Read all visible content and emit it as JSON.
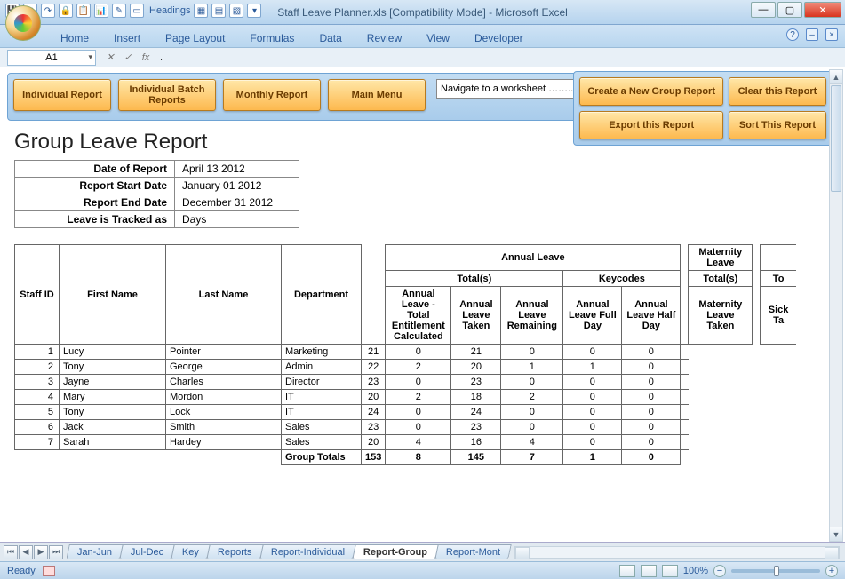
{
  "window": {
    "title": "Staff Leave Planner.xls  [Compatibility Mode] - Microsoft Excel",
    "qat_headings": "Headings"
  },
  "ribbon": {
    "tabs": [
      "Home",
      "Insert",
      "Page Layout",
      "Formulas",
      "Data",
      "Review",
      "View",
      "Developer"
    ]
  },
  "namebox": "A1",
  "formula": ".",
  "toolbar": {
    "individual_report": "Individual Report",
    "individual_batch": "Individual Batch Reports",
    "monthly_report": "Monthly Report",
    "main_menu": "Main Menu",
    "navigate_placeholder": "Navigate to a worksheet …….."
  },
  "right_buttons": {
    "create_new": "Create a New Group Report",
    "clear": "Clear this Report",
    "export": "Export this Report",
    "sort": "Sort This Report"
  },
  "report": {
    "title": "Group Leave Report",
    "meta": {
      "date_label": "Date of Report",
      "date_val": "April 13 2012",
      "start_label": "Report Start Date",
      "start_val": "January 01 2012",
      "end_label": "Report End Date",
      "end_val": "December 31 2012",
      "track_label": "Leave is Tracked as",
      "track_val": "Days"
    }
  },
  "headers": {
    "staff_id": "Staff ID",
    "first_name": "First Name",
    "last_name": "Last Name",
    "department": "Department",
    "annual_leave": "Annual Leave",
    "totals": "Total(s)",
    "keycodes": "Keycodes",
    "al_total_ent": "Annual Leave - Total Entitlement Calculated",
    "al_taken": "Annual Leave Taken",
    "al_remaining": "Annual Leave Remaining",
    "al_full": "Annual Leave Full Day",
    "al_half": "Annual Leave Half Day",
    "maternity": "Maternity Leave",
    "mat_taken": "Maternity Leave Taken",
    "sick": "Sick Ta",
    "to": "To",
    "group_totals": "Group Totals"
  },
  "chart_data": {
    "type": "table",
    "columns": [
      "Staff ID",
      "First Name",
      "Last Name",
      "Department",
      "Annual Leave - Total Entitlement Calculated",
      "Annual Leave Taken",
      "Annual Leave Remaining",
      "Annual Leave Full Day",
      "Annual Leave Half Day",
      "Maternity Leave Taken"
    ],
    "rows": [
      {
        "id": 1,
        "first": "Lucy",
        "last": "Pointer",
        "dept": "Marketing",
        "ent": 21,
        "taken": 0,
        "rem": 21,
        "full": 0,
        "half": 0,
        "mat": 0
      },
      {
        "id": 2,
        "first": "Tony",
        "last": "George",
        "dept": "Admin",
        "ent": 22,
        "taken": 2,
        "rem": 20,
        "full": 1,
        "half": 1,
        "mat": 0
      },
      {
        "id": 3,
        "first": "Jayne",
        "last": "Charles",
        "dept": "Director",
        "ent": 23,
        "taken": 0,
        "rem": 23,
        "full": 0,
        "half": 0,
        "mat": 0
      },
      {
        "id": 4,
        "first": "Mary",
        "last": "Mordon",
        "dept": "IT",
        "ent": 20,
        "taken": 2,
        "rem": 18,
        "full": 2,
        "half": 0,
        "mat": 0
      },
      {
        "id": 5,
        "first": "Tony",
        "last": "Lock",
        "dept": "IT",
        "ent": 24,
        "taken": 0,
        "rem": 24,
        "full": 0,
        "half": 0,
        "mat": 0
      },
      {
        "id": 6,
        "first": "Jack",
        "last": "Smith",
        "dept": "Sales",
        "ent": 23,
        "taken": 0,
        "rem": 23,
        "full": 0,
        "half": 0,
        "mat": 0
      },
      {
        "id": 7,
        "first": "Sarah",
        "last": "Hardey",
        "dept": "Sales",
        "ent": 20,
        "taken": 4,
        "rem": 16,
        "full": 4,
        "half": 0,
        "mat": 0
      }
    ],
    "totals": {
      "ent": 153,
      "taken": 8,
      "rem": 145,
      "full": 7,
      "half": 1,
      "mat": 0
    }
  },
  "sheet_tabs": [
    "Jan-Jun",
    "Jul-Dec",
    "Key",
    "Reports",
    "Report-Individual",
    "Report-Group",
    "Report-Mont"
  ],
  "active_tab": "Report-Group",
  "status": {
    "ready": "Ready",
    "zoom": "100%"
  }
}
